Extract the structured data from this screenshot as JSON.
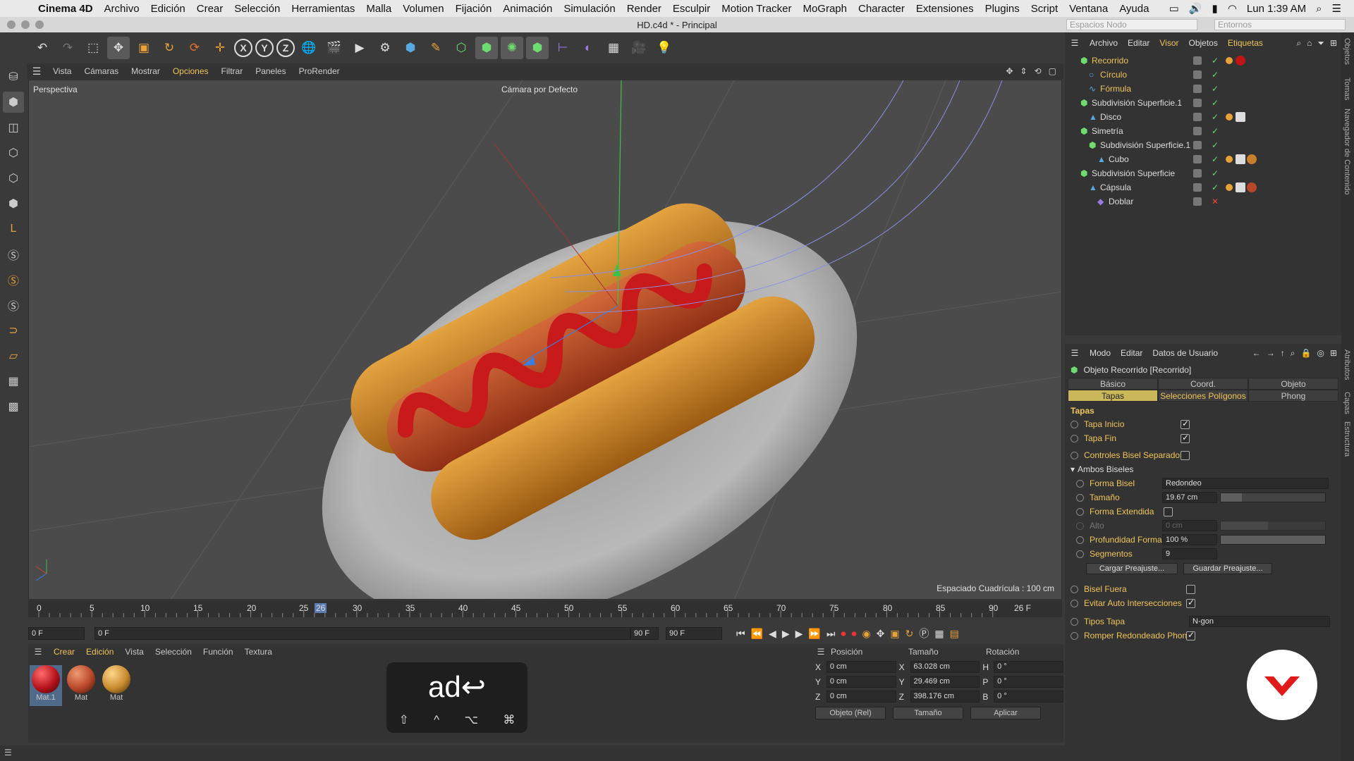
{
  "menubar": {
    "app": "Cinema 4D",
    "items": [
      "Archivo",
      "Edición",
      "Crear",
      "Selección",
      "Herramientas",
      "Malla",
      "Volumen",
      "Fijación",
      "Animación",
      "Simulación",
      "Render",
      "Esculpir",
      "Motion Tracker",
      "MoGraph",
      "Character",
      "Extensiones",
      "Plugins",
      "Script",
      "Ventana",
      "Ayuda"
    ],
    "clock": "Lun 1:39 AM"
  },
  "window": {
    "title": "HD.c4d * - Principal",
    "layout_dropdown": "Espacios Nodo",
    "env_dropdown": "Entornos"
  },
  "viewport_menu": [
    "Vista",
    "Cámaras",
    "Mostrar",
    "Opciones",
    "Filtrar",
    "Paneles",
    "ProRender"
  ],
  "viewport_menu_active": "Opciones",
  "viewport": {
    "label": "Perspectiva",
    "camera": "Cámara por Defecto",
    "grid_spacing": "Espaciado Cuadrícula : 100 cm"
  },
  "timeline": {
    "ticks": [
      "0",
      "5",
      "10",
      "15",
      "20",
      "25",
      "26",
      "30",
      "35",
      "40",
      "45",
      "50",
      "55",
      "60",
      "65",
      "70",
      "75",
      "80",
      "85",
      "90"
    ],
    "current_frame": "26 F",
    "start": "0 F",
    "range_start": "0 F",
    "range_end": "90 F",
    "end": "90 F"
  },
  "materials_menu": [
    "Crear",
    "Edición",
    "Vista",
    "Selección",
    "Función",
    "Textura"
  ],
  "materials": [
    {
      "name": "Mat.1",
      "color": "#b5121c"
    },
    {
      "name": "Mat",
      "color": "#b8472a"
    },
    {
      "name": "Mat",
      "color": "#c88a2e"
    }
  ],
  "coords": {
    "headers": [
      "Posición",
      "Tamaño",
      "Rotación"
    ],
    "rows": [
      {
        "axis": "X",
        "pos": "0 cm",
        "size_axis": "X",
        "size": "63.028 cm",
        "rot_axis": "H",
        "rot": "0 °"
      },
      {
        "axis": "Y",
        "pos": "0 cm",
        "size_axis": "Y",
        "size": "29.469 cm",
        "rot_axis": "P",
        "rot": "0 °"
      },
      {
        "axis": "Z",
        "pos": "0 cm",
        "size_axis": "Z",
        "size": "398.176 cm",
        "rot_axis": "B",
        "rot": "0 °"
      }
    ],
    "mode": "Objeto (Rel)",
    "size_mode": "Tamaño",
    "apply": "Aplicar"
  },
  "objects_menu": [
    "Archivo",
    "Editar",
    "Visor",
    "Objetos",
    "Etiquetas"
  ],
  "objects_menu_active": "Etiquetas",
  "objects": [
    {
      "name": "Recorrido",
      "indent": 0,
      "color": "orange",
      "tags": [
        "#e8a23a",
        "#c01515"
      ]
    },
    {
      "name": "Círculo",
      "indent": 1,
      "color": "orange",
      "tags": []
    },
    {
      "name": "Fórmula",
      "indent": 1,
      "color": "orange",
      "tags": []
    },
    {
      "name": "Subdivisión Superficie.1",
      "indent": 0,
      "color": "white",
      "tags": []
    },
    {
      "name": "Disco",
      "indent": 1,
      "color": "white",
      "tags": [
        "#e8a23a",
        "#ddd"
      ]
    },
    {
      "name": "Simetría",
      "indent": 0,
      "color": "white",
      "tags": []
    },
    {
      "name": "Subdivisión Superficie.1",
      "indent": 1,
      "color": "white",
      "tags": []
    },
    {
      "name": "Cubo",
      "indent": 2,
      "color": "white",
      "tags": [
        "#e8a23a",
        "#ddd",
        "#c8802e"
      ]
    },
    {
      "name": "Subdivisión Superficie",
      "indent": 0,
      "color": "white",
      "tags": []
    },
    {
      "name": "Cápsula",
      "indent": 1,
      "color": "white",
      "tags": [
        "#e8a23a",
        "#ddd",
        "#b8472a"
      ]
    },
    {
      "name": "Doblar",
      "indent": 2,
      "color": "white",
      "tags": []
    }
  ],
  "attributes_menu": [
    "Modo",
    "Editar",
    "Datos de Usuario"
  ],
  "attributes": {
    "object_title": "Objeto Recorrido [Recorrido]",
    "tabs_row1": [
      "Básico",
      "Coord.",
      "Objeto"
    ],
    "tabs_row2": [
      "Tapas",
      "Selecciones Polígonos",
      "Phong"
    ],
    "active_tab": "Tapas",
    "section": "Tapas",
    "tapa_inicio": "Tapa Inicio",
    "tapa_fin": "Tapa Fin",
    "controles": "Controles Bisel Separados",
    "ambos": "Ambos Biseles",
    "forma_bisel": "Forma Bisel",
    "forma_bisel_value": "Redondeo",
    "tamano": "Tamaño",
    "tamano_value": "19.67 cm",
    "forma_extendida": "Forma Extendida",
    "alto": "Alto",
    "alto_value": "0 cm",
    "profundidad": "Profundidad Forma",
    "profundidad_value": "100 %",
    "segmentos": "Segmentos",
    "segmentos_value": "9",
    "cargar": "Cargar Preajuste...",
    "guardar": "Guardar Preajuste...",
    "bisel_fuera": "Bisel Fuera",
    "evitar": "Evitar Auto Intersecciones",
    "tipos_tapa": "Tipos Tapa",
    "tipos_tapa_value": "N-gon",
    "romper": "Romper Redondeado Phong"
  },
  "right_strip": [
    "Objetos",
    "Tomas",
    "Navegador de Contenido",
    "Atributos",
    "Capas",
    "Estructura"
  ],
  "key_overlay": {
    "text": "ad↩",
    "mods": [
      "⇧",
      "^",
      "⌥",
      "⌘"
    ]
  }
}
